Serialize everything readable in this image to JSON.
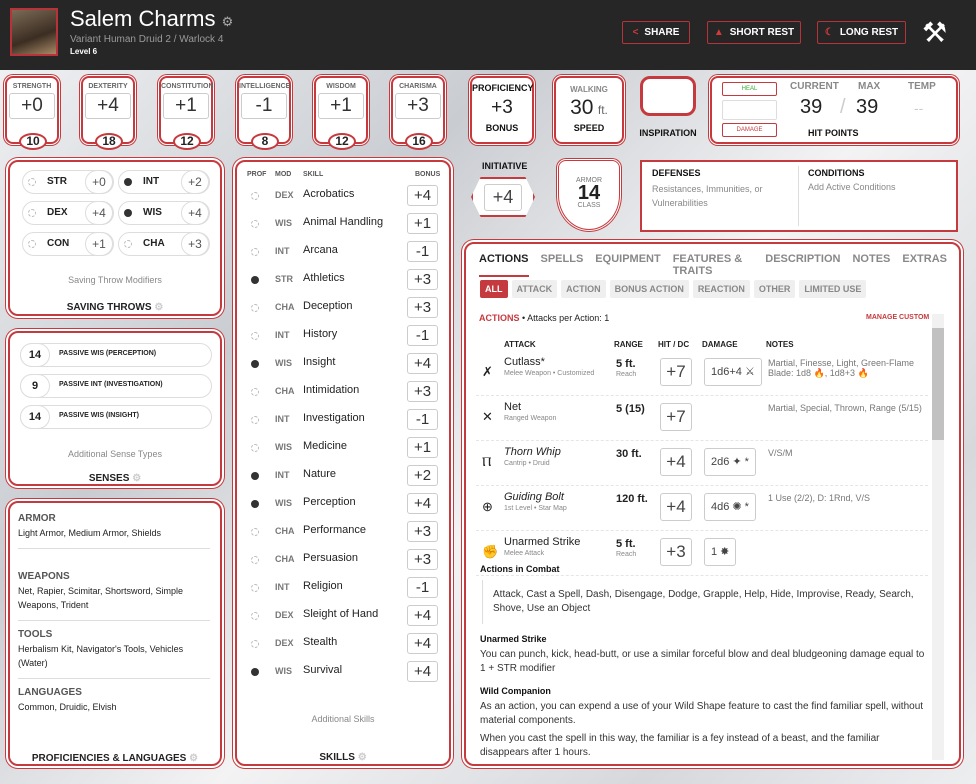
{
  "header": {
    "name": "Salem Charms",
    "subtitle": "Variant Human  Druid 2 / Warlock 4",
    "level": "Level 6",
    "share": "SHARE",
    "short_rest": "SHORT REST",
    "long_rest": "LONG REST"
  },
  "abilities": [
    {
      "name": "STRENGTH",
      "mod": "+0",
      "score": "10"
    },
    {
      "name": "DEXTERITY",
      "mod": "+4",
      "score": "18"
    },
    {
      "name": "CONSTITUTION",
      "mod": "+1",
      "score": "12"
    },
    {
      "name": "INTELLIGENCE",
      "mod": "-1",
      "score": "8"
    },
    {
      "name": "WISDOM",
      "mod": "+1",
      "score": "12"
    },
    {
      "name": "CHARISMA",
      "mod": "+3",
      "score": "16"
    }
  ],
  "proficiency": {
    "label": "PROFICIENCY",
    "value": "+3",
    "footer": "BONUS"
  },
  "speed": {
    "label": "WALKING",
    "value": "30",
    "unit": "ft.",
    "footer": "SPEED"
  },
  "inspiration": {
    "label": "INSPIRATION"
  },
  "hp": {
    "heal": "HEAL",
    "damage": "DAMAGE",
    "current_label": "CURRENT",
    "max_label": "MAX",
    "temp_label": "TEMP",
    "current": "39",
    "max": "39",
    "temp": "--",
    "sep": "/",
    "footer": "HIT POINTS"
  },
  "saves": {
    "items": [
      {
        "ab": "STR",
        "val": "+0",
        "prof": false
      },
      {
        "ab": "INT",
        "val": "+2",
        "prof": true
      },
      {
        "ab": "DEX",
        "val": "+4",
        "prof": false
      },
      {
        "ab": "WIS",
        "val": "+4",
        "prof": true
      },
      {
        "ab": "CON",
        "val": "+1",
        "prof": false
      },
      {
        "ab": "CHA",
        "val": "+3",
        "prof": false
      }
    ],
    "note": "Saving Throw Modifiers",
    "title": "SAVING THROWS"
  },
  "senses": {
    "items": [
      {
        "val": "14",
        "label": "PASSIVE WIS (PERCEPTION)"
      },
      {
        "val": "9",
        "label": "PASSIVE INT (INVESTIGATION)"
      },
      {
        "val": "14",
        "label": "PASSIVE WIS (INSIGHT)"
      }
    ],
    "note": "Additional Sense Types",
    "title": "SENSES"
  },
  "proficiencies": {
    "groups": [
      {
        "title": "ARMOR",
        "text": "Light Armor, Medium Armor, Shields"
      },
      {
        "title": "WEAPONS",
        "text": "Net, Rapier, Scimitar, Shortsword, Simple Weapons, Trident"
      },
      {
        "title": "TOOLS",
        "text": "Herbalism Kit, Navigator's Tools, Vehicles (Water)"
      },
      {
        "title": "LANGUAGES",
        "text": "Common, Druidic, Elvish"
      }
    ],
    "title": "PROFICIENCIES & LANGUAGES"
  },
  "skills": {
    "headers": {
      "prof": "PROF",
      "mod": "MOD",
      "skill": "SKILL",
      "bonus": "BONUS"
    },
    "items": [
      {
        "mod": "DEX",
        "name": "Acrobatics",
        "bonus": "+4",
        "prof": false
      },
      {
        "mod": "WIS",
        "name": "Animal Handling",
        "bonus": "+1",
        "prof": false
      },
      {
        "mod": "INT",
        "name": "Arcana",
        "bonus": "-1",
        "prof": false
      },
      {
        "mod": "STR",
        "name": "Athletics",
        "bonus": "+3",
        "prof": true
      },
      {
        "mod": "CHA",
        "name": "Deception",
        "bonus": "+3",
        "prof": false
      },
      {
        "mod": "INT",
        "name": "History",
        "bonus": "-1",
        "prof": false
      },
      {
        "mod": "WIS",
        "name": "Insight",
        "bonus": "+4",
        "prof": true
      },
      {
        "mod": "CHA",
        "name": "Intimidation",
        "bonus": "+3",
        "prof": false
      },
      {
        "mod": "INT",
        "name": "Investigation",
        "bonus": "-1",
        "prof": false
      },
      {
        "mod": "WIS",
        "name": "Medicine",
        "bonus": "+1",
        "prof": false
      },
      {
        "mod": "INT",
        "name": "Nature",
        "bonus": "+2",
        "prof": true
      },
      {
        "mod": "WIS",
        "name": "Perception",
        "bonus": "+4",
        "prof": true
      },
      {
        "mod": "CHA",
        "name": "Performance",
        "bonus": "+3",
        "prof": false
      },
      {
        "mod": "CHA",
        "name": "Persuasion",
        "bonus": "+3",
        "prof": false
      },
      {
        "mod": "INT",
        "name": "Religion",
        "bonus": "-1",
        "prof": false
      },
      {
        "mod": "DEX",
        "name": "Sleight of Hand",
        "bonus": "+4",
        "prof": false
      },
      {
        "mod": "DEX",
        "name": "Stealth",
        "bonus": "+4",
        "prof": false
      },
      {
        "mod": "WIS",
        "name": "Survival",
        "bonus": "+4",
        "prof": true
      }
    ],
    "note": "Additional Skills",
    "title": "SKILLS"
  },
  "initiative": {
    "label": "INITIATIVE",
    "value": "+4"
  },
  "armor": {
    "top": "ARMOR",
    "value": "14",
    "bottom": "CLASS"
  },
  "defenses": {
    "title": "DEFENSES",
    "text": "Resistances, Immunities, or Vulnerabilities"
  },
  "conditions": {
    "title": "CONDITIONS",
    "text": "Add Active Conditions"
  },
  "tabs": [
    "ACTIONS",
    "SPELLS",
    "EQUIPMENT",
    "FEATURES & TRAITS",
    "DESCRIPTION",
    "NOTES",
    "EXTRAS"
  ],
  "filters": [
    "ALL",
    "ATTACK",
    "ACTION",
    "BONUS ACTION",
    "REACTION",
    "OTHER",
    "LIMITED USE"
  ],
  "actions": {
    "title": "ACTIONS",
    "attacks_per": "• Attacks per Action: 1",
    "manage": "MANAGE CUSTOM",
    "headers": {
      "attack": "ATTACK",
      "range": "RANGE",
      "hit": "HIT / DC",
      "damage": "DAMAGE",
      "notes": "NOTES"
    },
    "attacks": [
      {
        "icon": "✗",
        "name": "Cutlass*",
        "sub": "Melee Weapon • Customized",
        "range": "5 ft.",
        "range_sub": "Reach",
        "hit": "+7",
        "damage": "1d6+4 ⚔",
        "notes": "Martial, Finesse, Light, Green-Flame Blade: 1d8 🔥, 1d8+3 🔥"
      },
      {
        "icon": "✕",
        "name": "Net",
        "sub": "Ranged Weapon",
        "range": "5 (15)",
        "range_sub": "",
        "hit": "+7",
        "damage": "",
        "notes": "Martial, Special, Thrown, Range (5/15)"
      },
      {
        "icon": "Ⲡ",
        "name": "Thorn Whip",
        "sub": "Cantrip • Druid",
        "range": "30 ft.",
        "range_sub": "",
        "hit": "+4",
        "damage": "2d6 ✦ *",
        "notes": "V/S/M"
      },
      {
        "icon": "⊕",
        "name": "Guiding Bolt",
        "sub": "1st Level • Star Map",
        "range": "120 ft.",
        "range_sub": "",
        "hit": "+4",
        "damage": "4d6 ✺ *",
        "notes": "1 Use (2/2), D: 1Rnd, V/S"
      },
      {
        "icon": "✊",
        "name": "Unarmed Strike",
        "sub": "Melee Attack",
        "range": "5 ft.",
        "range_sub": "Reach",
        "hit": "+3",
        "damage": "1 ✸",
        "notes": ""
      }
    ],
    "combat_title": "Actions in Combat",
    "combat_text": "Attack, Cast a Spell, Dash, Disengage, Dodge, Grapple, Help, Hide, Improvise, Ready, Search, Shove, Use an Object",
    "unarmed_title": "Unarmed Strike",
    "unarmed_text": "You can punch, kick, head-butt, or use a similar forceful blow and deal bludgeoning damage equal to 1 + STR modifier",
    "wild_title": "Wild Companion",
    "wild_text1": "As an action, you can expend a use of your Wild Shape feature to cast the find familiar spell, without material components.",
    "wild_text2": "When you cast the spell in this way, the familiar is a fey instead of a beast, and the familiar disappears after 1 hours."
  },
  "colors": {
    "accent": "#c53a3e",
    "header_bg": "#262626"
  }
}
